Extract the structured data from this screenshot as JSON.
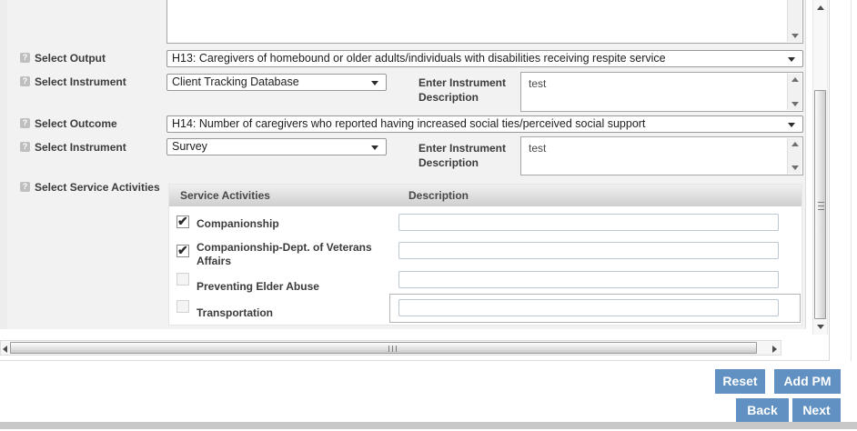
{
  "panel": {
    "notes_textarea": {
      "value": ""
    },
    "fields": {
      "output": {
        "label": "Select Output",
        "value": "H13: Caregivers of homebound or older adults/individuals with disabilities receiving respite service"
      },
      "instrument_1": {
        "label": "Select Instrument",
        "value": "Client Tracking Database",
        "description_label": "Enter Instrument Description",
        "description_value": "test"
      },
      "outcome": {
        "label": "Select Outcome",
        "value": "H14: Number of caregivers who reported having increased social ties/perceived social support"
      },
      "instrument_2": {
        "label": "Select Instrument",
        "value": "Survey",
        "description_label": "Enter Instrument Description",
        "description_value": "test"
      },
      "service_activities_label": "Select Service Activities"
    },
    "service_table": {
      "headers": {
        "activities": "Service Activities",
        "description": "Description"
      },
      "rows": [
        {
          "name": "Companionship",
          "checked": true,
          "description": ""
        },
        {
          "name": "Companionship-Dept. of Veterans Affairs",
          "checked": true,
          "description": ""
        },
        {
          "name": "Preventing Elder Abuse",
          "checked": false,
          "description": ""
        },
        {
          "name": "Transportation",
          "checked": false,
          "description": ""
        }
      ]
    },
    "help_icon_glyph": "?"
  },
  "buttons": {
    "reset": "Reset",
    "add_pm": "Add PM",
    "back": "Back",
    "next": "Next"
  },
  "colors": {
    "accent_blue": "#6191c2",
    "content_bg": "#f2f2f2",
    "table_header_top": "#f0f0f0",
    "table_header_bottom": "#cfcfcf",
    "bottom_strip": "#c8c8c8"
  }
}
